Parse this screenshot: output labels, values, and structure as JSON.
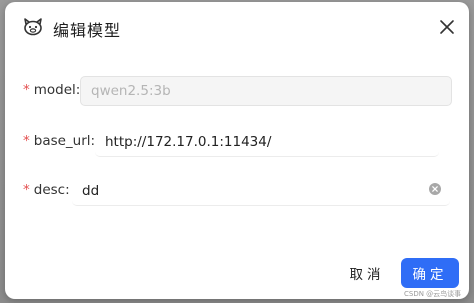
{
  "dialog": {
    "title": "编辑模型",
    "logo_icon": "llama-logo-icon",
    "close_icon": "close-icon"
  },
  "form": {
    "model": {
      "label": "model",
      "value": "qwen2.5:3b",
      "required": true,
      "disabled": true
    },
    "base_url": {
      "label": "base_url",
      "value": "http://172.17.0.1:11434/",
      "required": true
    },
    "desc": {
      "label": "desc",
      "value": "dd",
      "required": true,
      "clear_icon": "clear-circle-icon"
    }
  },
  "footer": {
    "cancel_label": "取消",
    "ok_label": "确定"
  },
  "watermark": "CSDN @云鸟谈事",
  "colors": {
    "primary": "#2f6df6",
    "required": "#e34d4d"
  }
}
